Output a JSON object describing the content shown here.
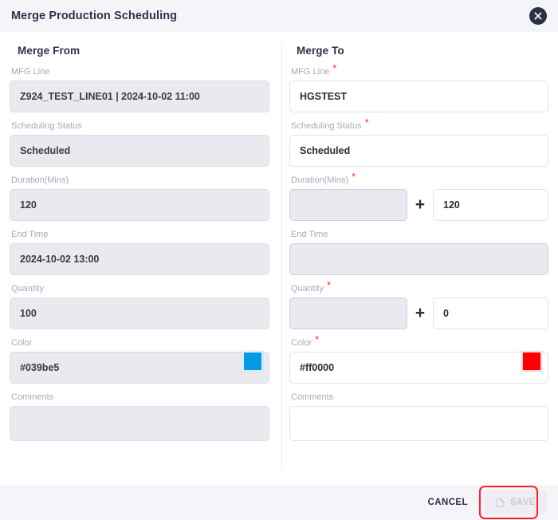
{
  "dialog": {
    "title": "Merge Production Scheduling",
    "close_icon": "close-icon"
  },
  "left_panel": {
    "heading": "Merge From",
    "fields": {
      "mfg_line": {
        "label": "MFG Line",
        "value": "Z924_TEST_LINE01 | 2024-10-02 11:00",
        "required": false,
        "disabled": true
      },
      "scheduling_status": {
        "label": "Scheduling Status",
        "value": "Scheduled",
        "required": false,
        "disabled": true
      },
      "duration": {
        "label": "Duration(Mins)",
        "value": "120",
        "required": false,
        "disabled": true
      },
      "end_time": {
        "label": "End Time",
        "value": "2024-10-02 13:00",
        "required": false,
        "disabled": true
      },
      "quantity": {
        "label": "Quantity",
        "value": "100",
        "required": false,
        "disabled": true
      },
      "color": {
        "label": "Color",
        "value": "#039be5",
        "swatch": "#039be5",
        "required": false,
        "disabled": true
      },
      "comments": {
        "label": "Comments",
        "value": "",
        "required": false,
        "disabled": true
      }
    }
  },
  "right_panel": {
    "heading": "Merge To",
    "fields": {
      "mfg_line": {
        "label": "MFG Line",
        "value": "HGSTEST",
        "required": true,
        "disabled": false
      },
      "scheduling_status": {
        "label": "Scheduling Status",
        "value": "Scheduled",
        "required": true,
        "disabled": false
      },
      "duration": {
        "label": "Duration(Mins)",
        "value_a": "",
        "operator": "+",
        "value_b": "120",
        "required": true
      },
      "end_time": {
        "label": "End Time",
        "value": "",
        "required": false,
        "disabled": true
      },
      "quantity": {
        "label": "Quantity",
        "value_a": "",
        "operator": "+",
        "value_b": "0",
        "required": true
      },
      "color": {
        "label": "Color",
        "value": "#ff0000",
        "swatch": "#ff0000",
        "required": true,
        "disabled": false
      },
      "comments": {
        "label": "Comments",
        "value": "",
        "required": false,
        "disabled": false
      }
    }
  },
  "footer": {
    "cancel_label": "CANCEL",
    "save_label": "SAVE",
    "save_icon": "save-document-icon",
    "save_disabled": true
  },
  "colors": {
    "header_bg": "#f5f4f9",
    "title_text": "#2d3049",
    "label_text": "#a8a8b8",
    "required_mark": "#ff2d2d",
    "disabled_field_bg": "#e9e9ef",
    "annotation": "#ff1f1f"
  }
}
